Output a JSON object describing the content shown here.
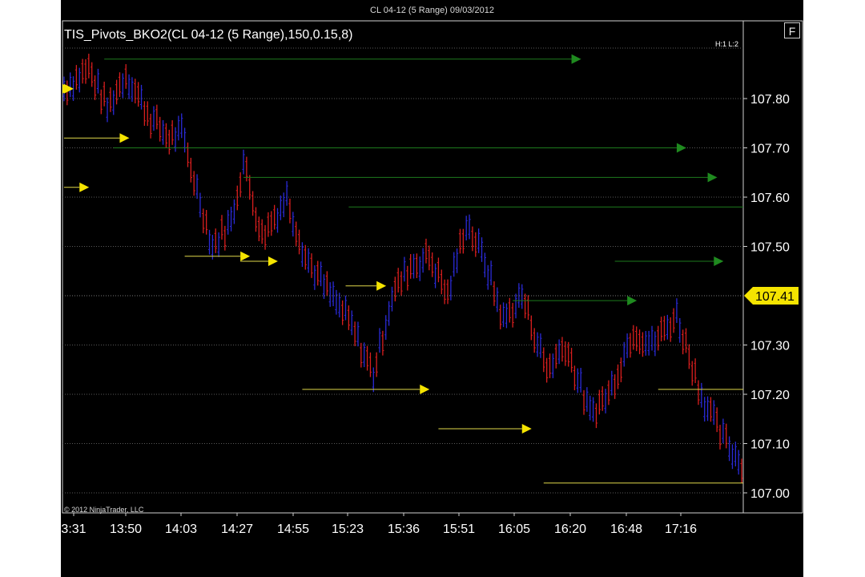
{
  "window": {
    "title": "CL 04-12 (5 Range)  09/03/2012",
    "f_button": "F"
  },
  "chart_data": {
    "type": "candlestick",
    "title": "TIS_Pivots_BKO2(CL 04-12 (5 Range),150,0.15,8)",
    "panel_label": "H:1 L:2",
    "copyright": "© 2012 NinjaTrader, LLC",
    "instrument": "CL 04-12",
    "bar_type": "5 Range",
    "date": "09/03/2012",
    "ylim": [
      106.98,
      107.9
    ],
    "yticks": [
      107.8,
      107.7,
      107.6,
      107.5,
      107.3,
      107.2,
      107.1,
      107.0
    ],
    "ytick_labels": [
      "107.80",
      "107.70",
      "107.60",
      "107.50",
      "107.30",
      "107.20",
      "107.10",
      "107.00"
    ],
    "grid_levels": [
      107.8,
      107.7,
      107.6,
      107.5,
      107.4,
      107.3,
      107.2,
      107.1,
      107.0
    ],
    "last_price": "107.41",
    "last_price_value": 107.4,
    "x_tick_labels": [
      "3:31",
      "13:50",
      "14:03",
      "14:27",
      "14:55",
      "15:23",
      "15:36",
      "15:51",
      "16:05",
      "16:20",
      "16:48",
      "17:16"
    ],
    "bar_count": 220,
    "bar_range": 0.05,
    "anchor_prices": [
      [
        0,
        107.82
      ],
      [
        8,
        107.86
      ],
      [
        14,
        107.78
      ],
      [
        20,
        107.85
      ],
      [
        28,
        107.76
      ],
      [
        34,
        107.72
      ],
      [
        38,
        107.73
      ],
      [
        48,
        107.5
      ],
      [
        54,
        107.55
      ],
      [
        58,
        107.67
      ],
      [
        64,
        107.52
      ],
      [
        72,
        107.6
      ],
      [
        78,
        107.48
      ],
      [
        84,
        107.42
      ],
      [
        92,
        107.35
      ],
      [
        100,
        107.24
      ],
      [
        106,
        107.4
      ],
      [
        112,
        107.46
      ],
      [
        118,
        107.48
      ],
      [
        124,
        107.4
      ],
      [
        130,
        107.55
      ],
      [
        136,
        107.47
      ],
      [
        142,
        107.35
      ],
      [
        148,
        107.4
      ],
      [
        156,
        107.25
      ],
      [
        162,
        107.3
      ],
      [
        170,
        107.16
      ],
      [
        176,
        107.2
      ],
      [
        184,
        107.33
      ],
      [
        190,
        107.3
      ],
      [
        198,
        107.36
      ],
      [
        206,
        107.2
      ],
      [
        212,
        107.12
      ],
      [
        220,
        107.05
      ]
    ],
    "series": [
      {
        "name": "bullish",
        "color": "#2a2ad6"
      },
      {
        "name": "bearish",
        "color": "#d81e1e"
      }
    ],
    "pivot_lines": [
      {
        "kind": "high",
        "price": 107.88,
        "start": 13,
        "end": 164,
        "color": "#1d7a1d"
      },
      {
        "kind": "high",
        "price": 107.7,
        "start": 16,
        "end": 198,
        "color": "#1d7a1d"
      },
      {
        "kind": "high",
        "price": 107.64,
        "start": 58,
        "end": 208,
        "color": "#1d7a1d"
      },
      {
        "kind": "high",
        "price": 107.58,
        "start": 92,
        "end": 220,
        "color": "#1d7a1d"
      },
      {
        "kind": "high",
        "price": 107.47,
        "start": 178,
        "end": 210,
        "color": "#1d7a1d"
      },
      {
        "kind": "high",
        "price": 107.39,
        "start": 145,
        "end": 182,
        "color": "#1d7a1d"
      },
      {
        "kind": "low",
        "price": 107.82,
        "start": -2,
        "end": 0,
        "color": "#e0d84a"
      },
      {
        "kind": "low",
        "price": 107.72,
        "start": 0,
        "end": 18,
        "color": "#e0d84a"
      },
      {
        "kind": "low",
        "price": 107.62,
        "start": 0,
        "end": 5,
        "color": "#e0d84a"
      },
      {
        "kind": "low",
        "price": 107.48,
        "start": 39,
        "end": 57,
        "color": "#e0d84a"
      },
      {
        "kind": "low",
        "price": 107.47,
        "start": 57,
        "end": 66,
        "color": "#e0d84a"
      },
      {
        "kind": "low",
        "price": 107.42,
        "start": 91,
        "end": 101,
        "color": "#e0d84a"
      },
      {
        "kind": "low",
        "price": 107.21,
        "start": 77,
        "end": 115,
        "color": "#e0d84a"
      },
      {
        "kind": "low",
        "price": 107.13,
        "start": 121,
        "end": 148,
        "color": "#e0d84a"
      },
      {
        "kind": "low",
        "price": 107.02,
        "start": 155,
        "end": 220,
        "color": "#e0d84a"
      },
      {
        "kind": "low",
        "price": 107.21,
        "start": 192,
        "end": 220,
        "color": "#e0d84a"
      }
    ]
  }
}
